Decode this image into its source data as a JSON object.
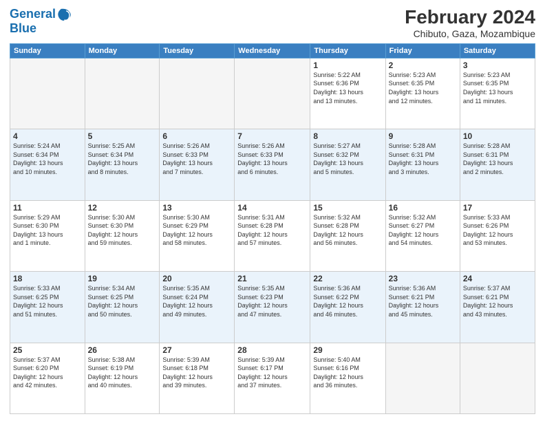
{
  "logo": {
    "line1": "General",
    "line2": "Blue"
  },
  "title": "February 2024",
  "subtitle": "Chibuto, Gaza, Mozambique",
  "days_of_week": [
    "Sunday",
    "Monday",
    "Tuesday",
    "Wednesday",
    "Thursday",
    "Friday",
    "Saturday"
  ],
  "weeks": [
    [
      {
        "num": "",
        "info": ""
      },
      {
        "num": "",
        "info": ""
      },
      {
        "num": "",
        "info": ""
      },
      {
        "num": "",
        "info": ""
      },
      {
        "num": "1",
        "info": "Sunrise: 5:22 AM\nSunset: 6:36 PM\nDaylight: 13 hours\nand 13 minutes."
      },
      {
        "num": "2",
        "info": "Sunrise: 5:23 AM\nSunset: 6:35 PM\nDaylight: 13 hours\nand 12 minutes."
      },
      {
        "num": "3",
        "info": "Sunrise: 5:23 AM\nSunset: 6:35 PM\nDaylight: 13 hours\nand 11 minutes."
      }
    ],
    [
      {
        "num": "4",
        "info": "Sunrise: 5:24 AM\nSunset: 6:34 PM\nDaylight: 13 hours\nand 10 minutes."
      },
      {
        "num": "5",
        "info": "Sunrise: 5:25 AM\nSunset: 6:34 PM\nDaylight: 13 hours\nand 8 minutes."
      },
      {
        "num": "6",
        "info": "Sunrise: 5:26 AM\nSunset: 6:33 PM\nDaylight: 13 hours\nand 7 minutes."
      },
      {
        "num": "7",
        "info": "Sunrise: 5:26 AM\nSunset: 6:33 PM\nDaylight: 13 hours\nand 6 minutes."
      },
      {
        "num": "8",
        "info": "Sunrise: 5:27 AM\nSunset: 6:32 PM\nDaylight: 13 hours\nand 5 minutes."
      },
      {
        "num": "9",
        "info": "Sunrise: 5:28 AM\nSunset: 6:31 PM\nDaylight: 13 hours\nand 3 minutes."
      },
      {
        "num": "10",
        "info": "Sunrise: 5:28 AM\nSunset: 6:31 PM\nDaylight: 13 hours\nand 2 minutes."
      }
    ],
    [
      {
        "num": "11",
        "info": "Sunrise: 5:29 AM\nSunset: 6:30 PM\nDaylight: 13 hours\nand 1 minute."
      },
      {
        "num": "12",
        "info": "Sunrise: 5:30 AM\nSunset: 6:30 PM\nDaylight: 12 hours\nand 59 minutes."
      },
      {
        "num": "13",
        "info": "Sunrise: 5:30 AM\nSunset: 6:29 PM\nDaylight: 12 hours\nand 58 minutes."
      },
      {
        "num": "14",
        "info": "Sunrise: 5:31 AM\nSunset: 6:28 PM\nDaylight: 12 hours\nand 57 minutes."
      },
      {
        "num": "15",
        "info": "Sunrise: 5:32 AM\nSunset: 6:28 PM\nDaylight: 12 hours\nand 56 minutes."
      },
      {
        "num": "16",
        "info": "Sunrise: 5:32 AM\nSunset: 6:27 PM\nDaylight: 12 hours\nand 54 minutes."
      },
      {
        "num": "17",
        "info": "Sunrise: 5:33 AM\nSunset: 6:26 PM\nDaylight: 12 hours\nand 53 minutes."
      }
    ],
    [
      {
        "num": "18",
        "info": "Sunrise: 5:33 AM\nSunset: 6:25 PM\nDaylight: 12 hours\nand 51 minutes."
      },
      {
        "num": "19",
        "info": "Sunrise: 5:34 AM\nSunset: 6:25 PM\nDaylight: 12 hours\nand 50 minutes."
      },
      {
        "num": "20",
        "info": "Sunrise: 5:35 AM\nSunset: 6:24 PM\nDaylight: 12 hours\nand 49 minutes."
      },
      {
        "num": "21",
        "info": "Sunrise: 5:35 AM\nSunset: 6:23 PM\nDaylight: 12 hours\nand 47 minutes."
      },
      {
        "num": "22",
        "info": "Sunrise: 5:36 AM\nSunset: 6:22 PM\nDaylight: 12 hours\nand 46 minutes."
      },
      {
        "num": "23",
        "info": "Sunrise: 5:36 AM\nSunset: 6:21 PM\nDaylight: 12 hours\nand 45 minutes."
      },
      {
        "num": "24",
        "info": "Sunrise: 5:37 AM\nSunset: 6:21 PM\nDaylight: 12 hours\nand 43 minutes."
      }
    ],
    [
      {
        "num": "25",
        "info": "Sunrise: 5:37 AM\nSunset: 6:20 PM\nDaylight: 12 hours\nand 42 minutes."
      },
      {
        "num": "26",
        "info": "Sunrise: 5:38 AM\nSunset: 6:19 PM\nDaylight: 12 hours\nand 40 minutes."
      },
      {
        "num": "27",
        "info": "Sunrise: 5:39 AM\nSunset: 6:18 PM\nDaylight: 12 hours\nand 39 minutes."
      },
      {
        "num": "28",
        "info": "Sunrise: 5:39 AM\nSunset: 6:17 PM\nDaylight: 12 hours\nand 37 minutes."
      },
      {
        "num": "29",
        "info": "Sunrise: 5:40 AM\nSunset: 6:16 PM\nDaylight: 12 hours\nand 36 minutes."
      },
      {
        "num": "",
        "info": ""
      },
      {
        "num": "",
        "info": ""
      }
    ]
  ]
}
